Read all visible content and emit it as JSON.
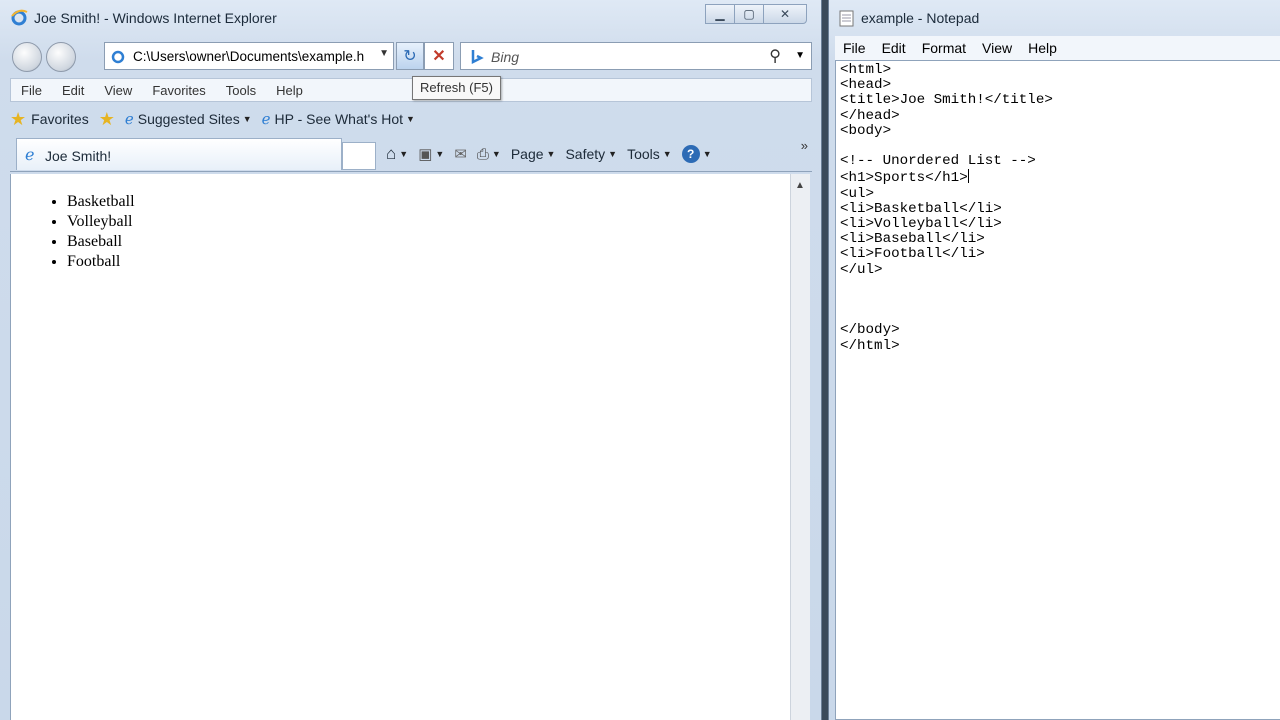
{
  "ie": {
    "title": "Joe Smith! - Windows Internet Explorer",
    "address": "C:\\Users\\owner\\Documents\\example.h",
    "search_placeholder": "Bing",
    "tooltip": "Refresh (F5)",
    "menu": [
      "File",
      "Edit",
      "View",
      "Favorites",
      "Tools",
      "Help"
    ],
    "favorites": {
      "label": "Favorites",
      "suggested": "Suggested Sites",
      "hp": "HP - See What's Hot"
    },
    "tab_title": "Joe Smith!",
    "commands": {
      "page": "Page",
      "safety": "Safety",
      "tools": "Tools"
    },
    "list": [
      "Basketball",
      "Volleyball",
      "Baseball",
      "Football"
    ]
  },
  "notepad": {
    "title": "example - Notepad",
    "menu": [
      "File",
      "Edit",
      "Format",
      "View",
      "Help"
    ],
    "lines": [
      "<html>",
      "<head>",
      "<title>Joe Smith!</title>",
      "</head>",
      "<body>",
      "",
      "<!-- Unordered List -->",
      "<h1>Sports</h1>",
      "<ul>",
      "<li>Basketball</li>",
      "<li>Volleyball</li>",
      "<li>Baseball</li>",
      "<li>Football</li>",
      "</ul>",
      "",
      "",
      "",
      "</body>",
      "</html>"
    ]
  },
  "colors": {
    "accent": "#2d6bb5",
    "stop": "#c23b2b",
    "chrome": "#cfdcec"
  }
}
